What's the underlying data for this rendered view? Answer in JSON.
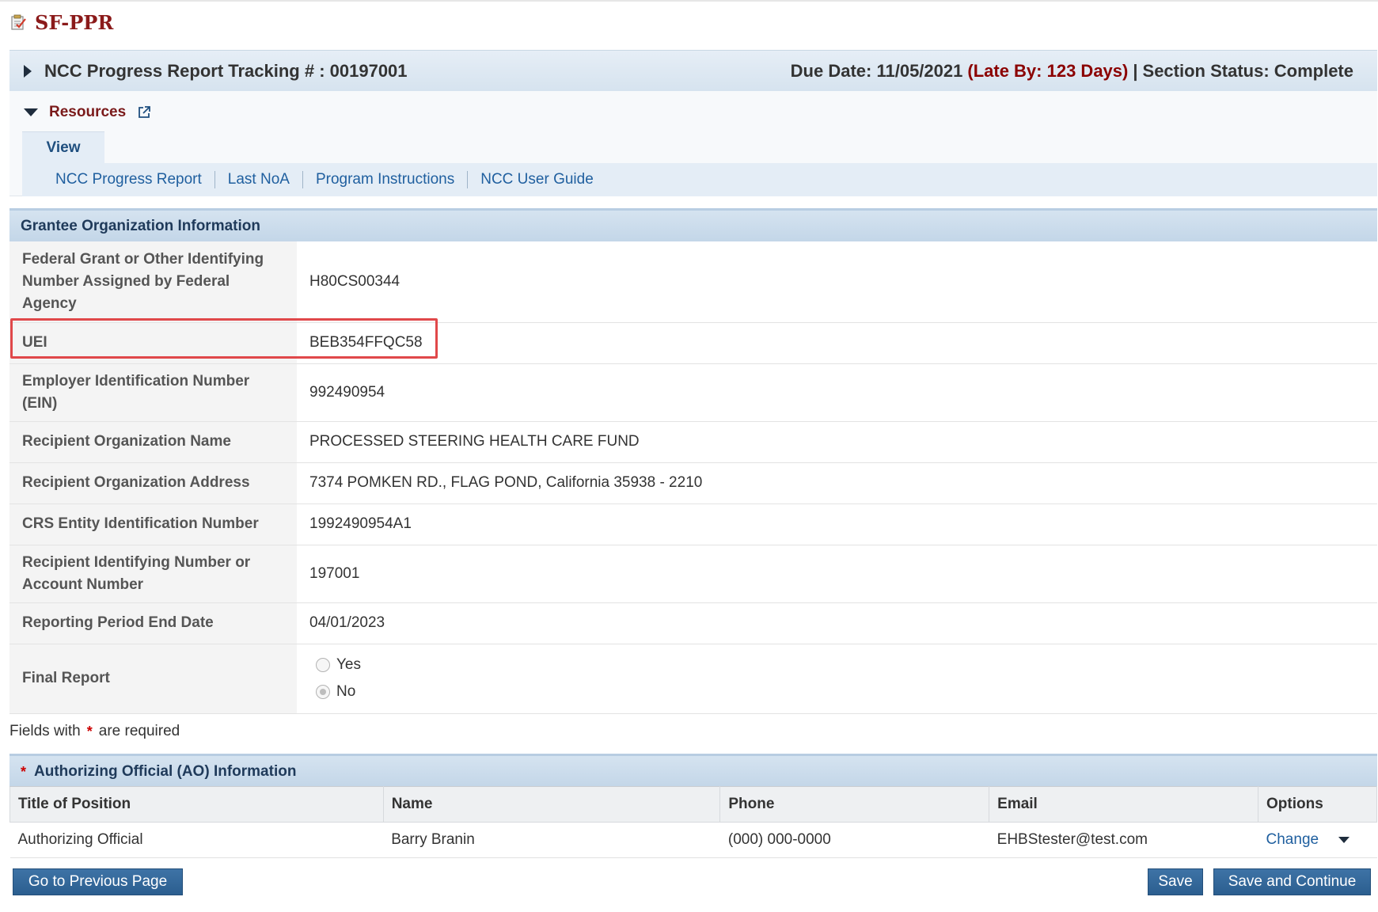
{
  "header": {
    "app_title": "SF-PPR",
    "app_icon": "report-icon"
  },
  "tracking": {
    "title": "NCC Progress Report Tracking # : 00197001",
    "due_date": "Due Date: 11/05/2021",
    "late_by": "(Late By: 123 Days)",
    "separator": "|",
    "section_status": "Section Status: Complete"
  },
  "resources": {
    "label": "Resources",
    "view_tab": "View",
    "links": [
      "NCC Progress Report",
      "Last NoA",
      "Program Instructions",
      "NCC User Guide"
    ]
  },
  "grantee": {
    "section_title": "Grantee Organization Information",
    "rows": [
      {
        "label": "Federal Grant or Other Identifying Number Assigned by Federal Agency",
        "value": "H80CS00344"
      },
      {
        "label": "UEI",
        "value": "BEB354FFQC58"
      },
      {
        "label": "Employer Identification Number (EIN)",
        "value": "992490954"
      },
      {
        "label": "Recipient Organization Name",
        "value": "PROCESSED STEERING HEALTH CARE FUND"
      },
      {
        "label": "Recipient Organization Address",
        "value": "7374 POMKEN RD., FLAG POND, California 35938 - 2210"
      },
      {
        "label": "CRS Entity Identification Number",
        "value": "1992490954A1"
      },
      {
        "label": "Recipient Identifying Number or Account Number",
        "value": "197001"
      },
      {
        "label": "Reporting Period End Date",
        "value": "04/01/2023"
      }
    ],
    "final_report": {
      "label": "Final Report",
      "options": [
        "Yes",
        "No"
      ],
      "selected": "No"
    }
  },
  "required_note": {
    "prefix": "Fields with",
    "star": "*",
    "suffix": "are required"
  },
  "ao": {
    "section_title": "Authorizing Official (AO) Information",
    "columns": [
      "Title of Position",
      "Name",
      "Phone",
      "Email",
      "Options"
    ],
    "row": {
      "title": "Authorizing Official",
      "name": "Barry Branin",
      "phone": "(000) 000-0000",
      "email": "EHBStester@test.com",
      "option": "Change"
    }
  },
  "buttons": {
    "previous": "Go to Previous Page",
    "save": "Save",
    "save_continue": "Save and Continue"
  },
  "colors": {
    "accent": "#2b5e8f",
    "late": "#8b0000",
    "highlight": "#e0484a"
  }
}
